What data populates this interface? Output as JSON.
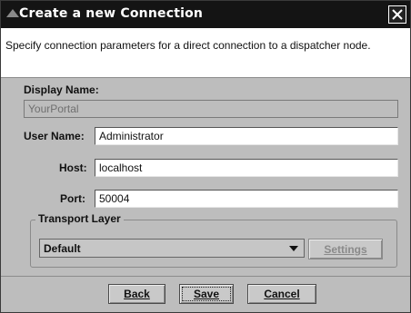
{
  "window": {
    "title": "Create a new Connection",
    "description": "Specify connection parameters for a direct connection to a dispatcher node."
  },
  "form": {
    "display_name_label": "Display Name:",
    "display_name_value": "YourPortal",
    "user_name_label": "User Name:",
    "user_name_value": "Administrator",
    "host_label": "Host:",
    "host_value": "localhost",
    "port_label": "Port:",
    "port_value": "50004"
  },
  "transport": {
    "group_title": "Transport Layer",
    "selected": "Default",
    "settings_label": "Settings"
  },
  "buttons": {
    "back": "Back",
    "save": "Save",
    "cancel": "Cancel"
  }
}
